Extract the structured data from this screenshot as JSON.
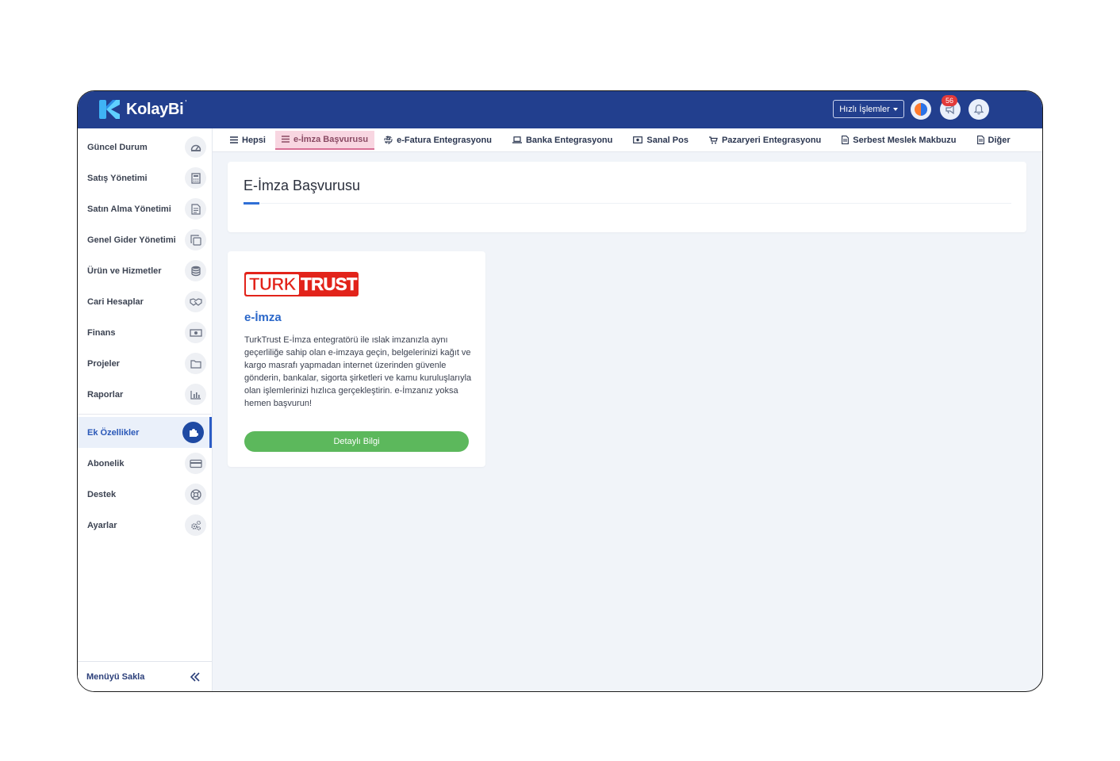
{
  "app": {
    "brand": "KolayBi",
    "brand_mark": "'",
    "colors": {
      "topbar": "#223f8e",
      "accent": "#2f6fd6",
      "button": "#5cb85c",
      "badge": "#e23a3a",
      "active_tab": "#f8d6e1"
    }
  },
  "header": {
    "quick_actions": "Hızlı İşlemler",
    "notification_count": "56",
    "icons": [
      "app-logo-icon",
      "megaphone-icon",
      "bell-icon"
    ]
  },
  "sidebar": {
    "items": [
      {
        "label": "Güncel Durum",
        "icon": "dashboard-icon"
      },
      {
        "label": "Satış Yönetimi",
        "icon": "calculator-icon"
      },
      {
        "label": "Satın Alma Yönetimi",
        "icon": "document-icon"
      },
      {
        "label": "Genel Gider Yönetimi",
        "icon": "copy-icon"
      },
      {
        "label": "Ürün ve Hizmetler",
        "icon": "database-icon"
      },
      {
        "label": "Cari Hesaplar",
        "icon": "handshake-icon"
      },
      {
        "label": "Finans",
        "icon": "money-icon"
      },
      {
        "label": "Projeler",
        "icon": "folder-icon"
      },
      {
        "label": "Raporlar",
        "icon": "bar-chart-icon"
      },
      {
        "label": "Ek Özellikler",
        "icon": "puzzle-icon",
        "active": true
      },
      {
        "label": "Abonelik",
        "icon": "credit-card-icon"
      },
      {
        "label": "Destek",
        "icon": "lifebuoy-icon"
      },
      {
        "label": "Ayarlar",
        "icon": "cogs-icon"
      }
    ],
    "collapse_label": "Menüyü Sakla"
  },
  "tabs": [
    {
      "label": "Hepsi",
      "icon": "list-icon"
    },
    {
      "label": "e-İmza Başvurusu",
      "icon": "list-icon",
      "active": true
    },
    {
      "label": "e-Fatura Entegrasyonu",
      "icon": "recycle-icon"
    },
    {
      "label": "Banka Entegrasyonu",
      "icon": "laptop-icon"
    },
    {
      "label": "Sanal Pos",
      "icon": "money-icon"
    },
    {
      "label": "Pazaryeri Entegrasyonu",
      "icon": "cart-icon"
    },
    {
      "label": "Serbest Meslek Makbuzu",
      "icon": "file-icon"
    },
    {
      "label": "Diğer",
      "icon": "file-icon"
    }
  ],
  "page": {
    "title": "E-İmza Başvurusu"
  },
  "card": {
    "logo_text_left": "TURK",
    "logo_text_right": "TRUST",
    "title": "e-İmza",
    "description": "TurkTrust E-İmza entegratörü ile ıslak imzanızla aynı geçerliliğe sahip olan e-imzaya geçin, belgelerinizi kağıt ve kargo masrafı yapmadan internet üzerinden güvenle gönderin, bankalar, sigorta şirketleri ve kamu kuruluşlarıyla olan işlemlerinizi hızlıca gerçekleştirin. e-İmzanız yoksa hemen başvurun!",
    "button": "Detaylı Bilgi"
  }
}
